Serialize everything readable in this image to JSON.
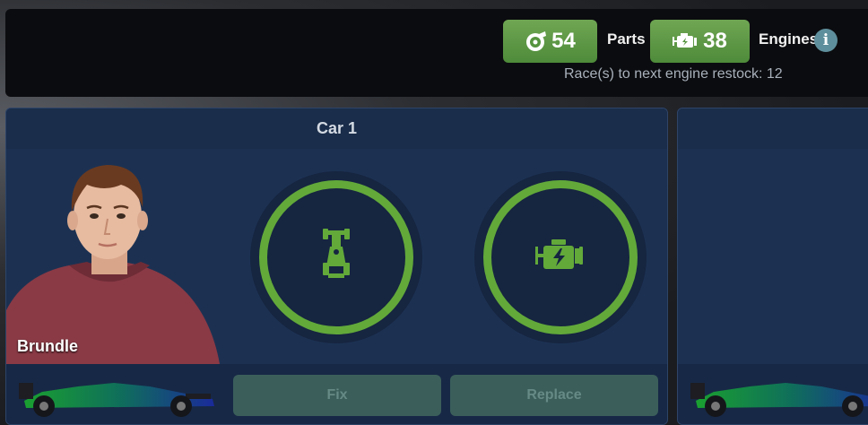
{
  "resources": {
    "parts_count": "54",
    "parts_label": "Parts",
    "engines_count": "38",
    "engines_label": "Engines",
    "restock_text": "Race(s) to next engine restock: 12",
    "info_glyph": "i"
  },
  "cards": [
    {
      "title": "Car 1",
      "driver_name": "Brundle",
      "fix_label": "Fix",
      "replace_label": "Replace",
      "chassis_icon": "car-chassis-icon",
      "engine_icon": "engine-icon"
    }
  ],
  "colors": {
    "accent_green": "#62a93a",
    "button_green": "#5a9a44",
    "card_bg": "#1b2e4f",
    "disabled_button": "#3b5e5a"
  }
}
